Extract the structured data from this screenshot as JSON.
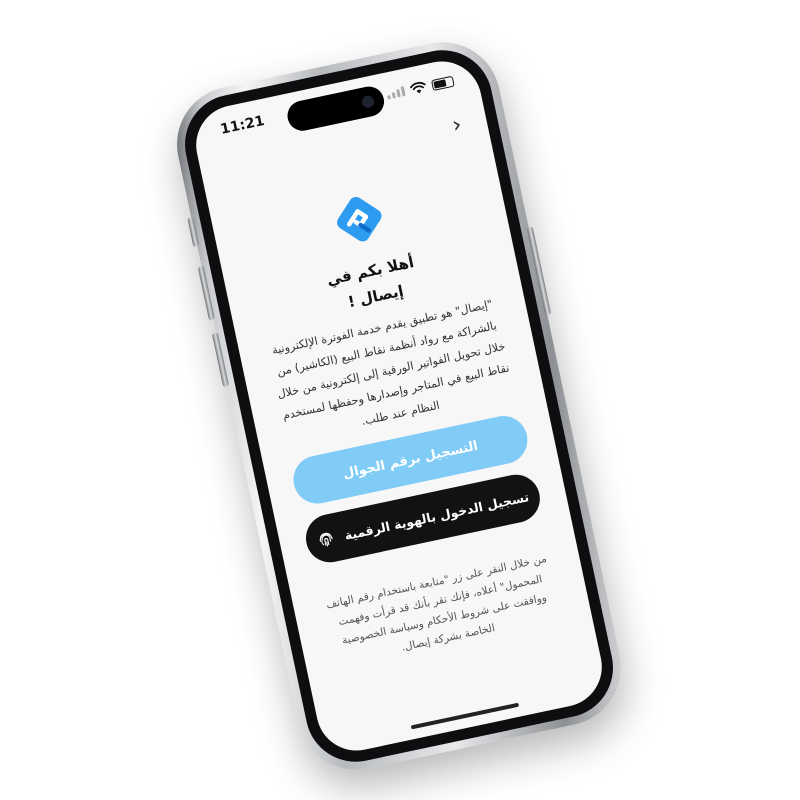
{
  "status": {
    "time": "11:21"
  },
  "header": {
    "back_icon": "chevron-right-icon"
  },
  "brand": {
    "logo_icon": "esal-logo-icon",
    "accent": "#1f8ef1"
  },
  "welcome": {
    "title_line1": "أهلا بكم في",
    "title_line2": "إيصال !",
    "description": "\"إيصال\" هو تطبيق يقدم خدمة الفوترة الإلكترونية بالشراكة مع رواد أنظمة نقاط البيع (الكاشير) من خلال تحويل الفواتير الورقية إلى إلكترونية من خلال نقاط البيع في المتاجر وإصدارها وحفظها لمستخدم النظام عند طلب."
  },
  "actions": {
    "phone_login_label": "التسجيل برقم الجوال",
    "digital_id_label": "تسجيل الدخول بالهوية الرقمية",
    "digital_id_icon": "fingerprint-icon",
    "primary_color": "#80ccf7",
    "dark_color": "#121213"
  },
  "footer": {
    "terms": "من خلال النقر على زر \"متابعة باستخدام رقم الهاتف المحمول\" أعلاه، فإنك تقر بأنك قد قرأت وفهمت ووافقت على شروط الأحكام وسياسة الخصوصية الخاصة بشركة إيصال."
  }
}
